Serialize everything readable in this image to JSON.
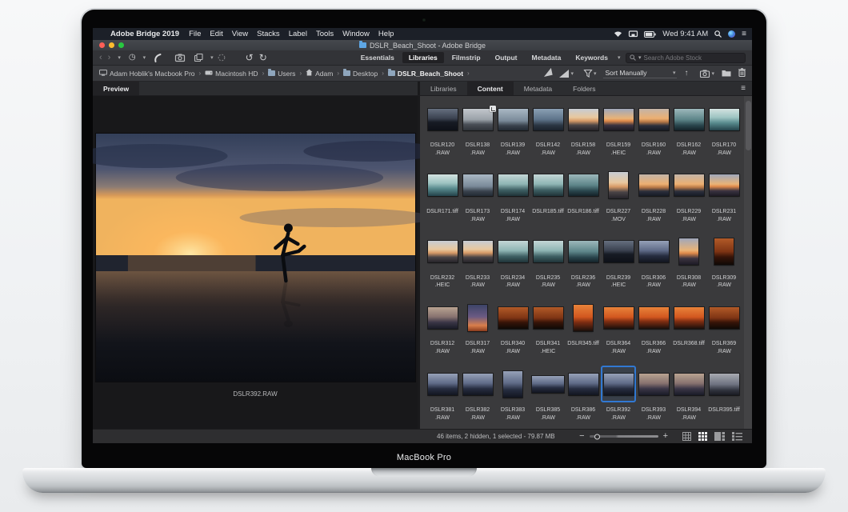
{
  "device": {
    "bezel_label": "MacBook Pro"
  },
  "menubar": {
    "apple": "",
    "app_name": "Adobe Bridge 2019",
    "items": [
      "File",
      "Edit",
      "View",
      "Stacks",
      "Label",
      "Tools",
      "Window",
      "Help"
    ],
    "clock": "Wed 9:41 AM"
  },
  "window": {
    "title": "DSLR_Beach_Shoot - Adobe Bridge"
  },
  "toolbar": {
    "workspaces": [
      "Essentials",
      "Libraries",
      "Filmstrip",
      "Output",
      "Metadata",
      "Keywords"
    ],
    "active_workspace": "Libraries",
    "search_placeholder": "Search Adobe Stock"
  },
  "pathbar": {
    "crumbs": [
      {
        "label": "Adam Hoblik's Macbook Pro",
        "icon": "computer"
      },
      {
        "label": "Macintosh HD",
        "icon": "drive"
      },
      {
        "label": "Users",
        "icon": "folder"
      },
      {
        "label": "Adam",
        "icon": "home"
      },
      {
        "label": "Desktop",
        "icon": "folder"
      },
      {
        "label": "DSLR_Beach_Shoot",
        "icon": "folder"
      }
    ],
    "sort_label": "Sort Manually"
  },
  "panels": {
    "left_tab": "Preview",
    "right_tabs": [
      "Libraries",
      "Content",
      "Metadata",
      "Folders"
    ],
    "active_right_tab": "Content"
  },
  "preview": {
    "caption": "DSLR392.RAW"
  },
  "content": {
    "items": [
      {
        "name": "DSLR120",
        "ext": ".RAW",
        "look": "dark"
      },
      {
        "name": "DSLR138",
        "ext": ".RAW",
        "look": "graybeach",
        "badge": "crop"
      },
      {
        "name": "DSLR139",
        "ext": ".RAW",
        "look": "clouds"
      },
      {
        "name": "DSLR142",
        "ext": ".RAW",
        "look": "blueclouds"
      },
      {
        "name": "DSLR158",
        "ext": ".RAW",
        "look": "palesun"
      },
      {
        "name": "DSLR159",
        "ext": ".HEIC",
        "look": "sunset"
      },
      {
        "name": "DSLR160",
        "ext": ".RAW",
        "look": "sunsetsea"
      },
      {
        "name": "DSLR162",
        "ext": ".RAW",
        "look": "tealdark"
      },
      {
        "name": "DSLR170",
        "ext": ".RAW",
        "look": "tealboat"
      },
      {
        "name": "DSLR171",
        "ext": ".tiff",
        "look": "tealboat"
      },
      {
        "name": "DSLR173",
        "ext": ".RAW",
        "look": "clouds"
      },
      {
        "name": "DSLR174",
        "ext": ".RAW",
        "look": "teal"
      },
      {
        "name": "DSLR185",
        "ext": ".tiff",
        "look": "teal"
      },
      {
        "name": "DSLR186",
        "ext": ".tiff",
        "look": "tealdark"
      },
      {
        "name": "DSLR227",
        "ext": ".MOV",
        "look": "palesun",
        "shape": "portrait"
      },
      {
        "name": "DSLR228",
        "ext": ".RAW",
        "look": "sunsetsea"
      },
      {
        "name": "DSLR229",
        "ext": ".RAW",
        "look": "sunsetsea"
      },
      {
        "name": "DSLR231",
        "ext": ".RAW",
        "look": "sunset"
      },
      {
        "name": "DSLR232",
        "ext": ".HEIC",
        "look": "palesun"
      },
      {
        "name": "DSLR233",
        "ext": ".RAW",
        "look": "palesun"
      },
      {
        "name": "DSLR234",
        "ext": ".RAW",
        "look": "teal"
      },
      {
        "name": "DSLR235",
        "ext": ".RAW",
        "look": "teal"
      },
      {
        "name": "DSLR236",
        "ext": ".RAW",
        "look": "tealdark"
      },
      {
        "name": "DSLR239",
        "ext": ".HEIC",
        "look": "dark"
      },
      {
        "name": "DSLR306",
        "ext": ".RAW",
        "look": "dusk"
      },
      {
        "name": "DSLR308",
        "ext": ".RAW",
        "look": "sunset",
        "shape": "portrait"
      },
      {
        "name": "DSLR309",
        "ext": ".RAW",
        "look": "orangedark",
        "shape": "portrait"
      },
      {
        "name": "DSLR312",
        "ext": ".RAW",
        "look": "duskwarm"
      },
      {
        "name": "DSLR317",
        "ext": ".RAW",
        "look": "purple",
        "shape": "portrait"
      },
      {
        "name": "DSLR340",
        "ext": ".RAW",
        "look": "orangedark"
      },
      {
        "name": "DSLR341",
        "ext": ".HEIC",
        "look": "orangedark"
      },
      {
        "name": "DSLR345",
        "ext": ".tiff",
        "look": "orange",
        "shape": "portrait"
      },
      {
        "name": "DSLR364",
        "ext": ".RAW",
        "look": "orange"
      },
      {
        "name": "DSLR366",
        "ext": ".RAW",
        "look": "orange"
      },
      {
        "name": "DSLR368",
        "ext": ".tiff",
        "look": "orange"
      },
      {
        "name": "DSLR369",
        "ext": ".RAW",
        "look": "orangedark"
      },
      {
        "name": "DSLR381",
        "ext": ".RAW",
        "look": "dusk"
      },
      {
        "name": "DSLR382",
        "ext": ".RAW",
        "look": "dusk"
      },
      {
        "name": "DSLR383",
        "ext": ".RAW",
        "look": "dusk",
        "shape": "portrait"
      },
      {
        "name": "DSLR385",
        "ext": ".RAW",
        "look": "dusk",
        "shape": "pano"
      },
      {
        "name": "DSLR386",
        "ext": ".RAW",
        "look": "dusk"
      },
      {
        "name": "DSLR392",
        "ext": ".RAW",
        "look": "dusk",
        "selected": true
      },
      {
        "name": "DSLR393",
        "ext": ".RAW",
        "look": "duskwarm"
      },
      {
        "name": "DSLR394",
        "ext": ".RAW",
        "look": "duskwarm"
      },
      {
        "name": "DSLR395",
        "ext": ".tiff",
        "look": "duskgray"
      }
    ]
  },
  "statusbar": {
    "summary": "46 items, 2 hidden, 1 selected - 79.87 MB"
  },
  "colors": {
    "selection_blue": "#3178d2",
    "folder_blue": "#5ea7e5"
  }
}
